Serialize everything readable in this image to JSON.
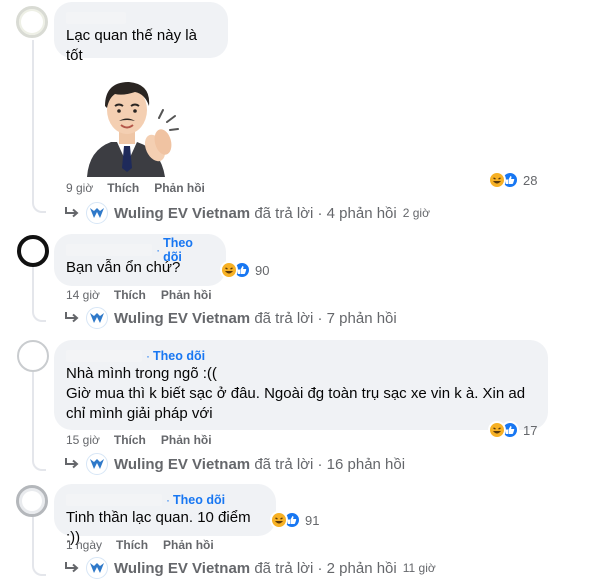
{
  "comments": [
    {
      "text": "Lạc quan thế này là tốt",
      "follow": "",
      "time": "9 giờ",
      "reaction_count": "28",
      "sticker": "clapping-man-sticker",
      "reply": {
        "page": "Wuling EV Vietnam",
        "summary": "đã trả lời · 4 phản hồi",
        "ago": "2 giờ"
      }
    },
    {
      "text": "Bạn vẫn ổn chứ?",
      "follow": "Theo dõi",
      "time": "14 giờ",
      "reaction_count": "90",
      "reply": {
        "page": "Wuling EV Vietnam",
        "summary": "đã trả lời · 7 phản hồi",
        "ago": ""
      }
    },
    {
      "text": "Nhà mình trong ngõ :((\nGiờ mua thì k biết sạc ở đâu. Ngoài đg toàn trụ sạc xe vin k à. Xin ad\nchỉ mình giải pháp với",
      "follow": "Theo dõi",
      "time": "15 giờ",
      "reaction_count": "17",
      "reply": {
        "page": "Wuling EV Vietnam",
        "summary": "đã trả lời · 16 phản hồi",
        "ago": ""
      }
    },
    {
      "text": "Tinh thần lạc quan. 10 điểm :))",
      "follow": "Theo dõi",
      "time": "1 ngày",
      "reaction_count": "91",
      "reply": {
        "page": "Wuling EV Vietnam",
        "summary": "đã trả lời · 2 phản hồi",
        "ago": "11 giờ"
      }
    }
  ],
  "actions": {
    "like": "Thích",
    "reply": "Phản hồi"
  },
  "colors": {
    "link": "#1877f2",
    "meta": "#65676b",
    "bubble": "#f0f2f5",
    "haha": "#f7b125",
    "like": "#1877f2"
  },
  "icons": [
    "reply-arrow-icon",
    "haha-reaction-icon",
    "like-reaction-icon",
    "page-logo-icon"
  ]
}
